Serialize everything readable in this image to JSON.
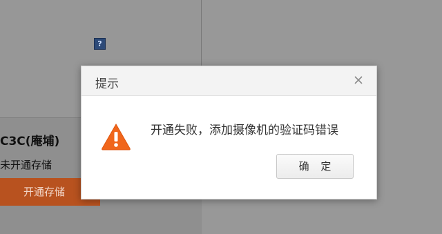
{
  "background": {
    "help_icon_glyph": "?",
    "camera_name": "C3C(庵埔)",
    "storage_status": "未开通存储",
    "open_storage_label": "开通存储"
  },
  "dialog": {
    "title": "提示",
    "message": "开通失败，添加摄像机的验证码错误",
    "confirm_label": "确 定",
    "close_icon": "close-icon",
    "warning_icon": "warning-icon",
    "warning_color": "#f0661c"
  }
}
